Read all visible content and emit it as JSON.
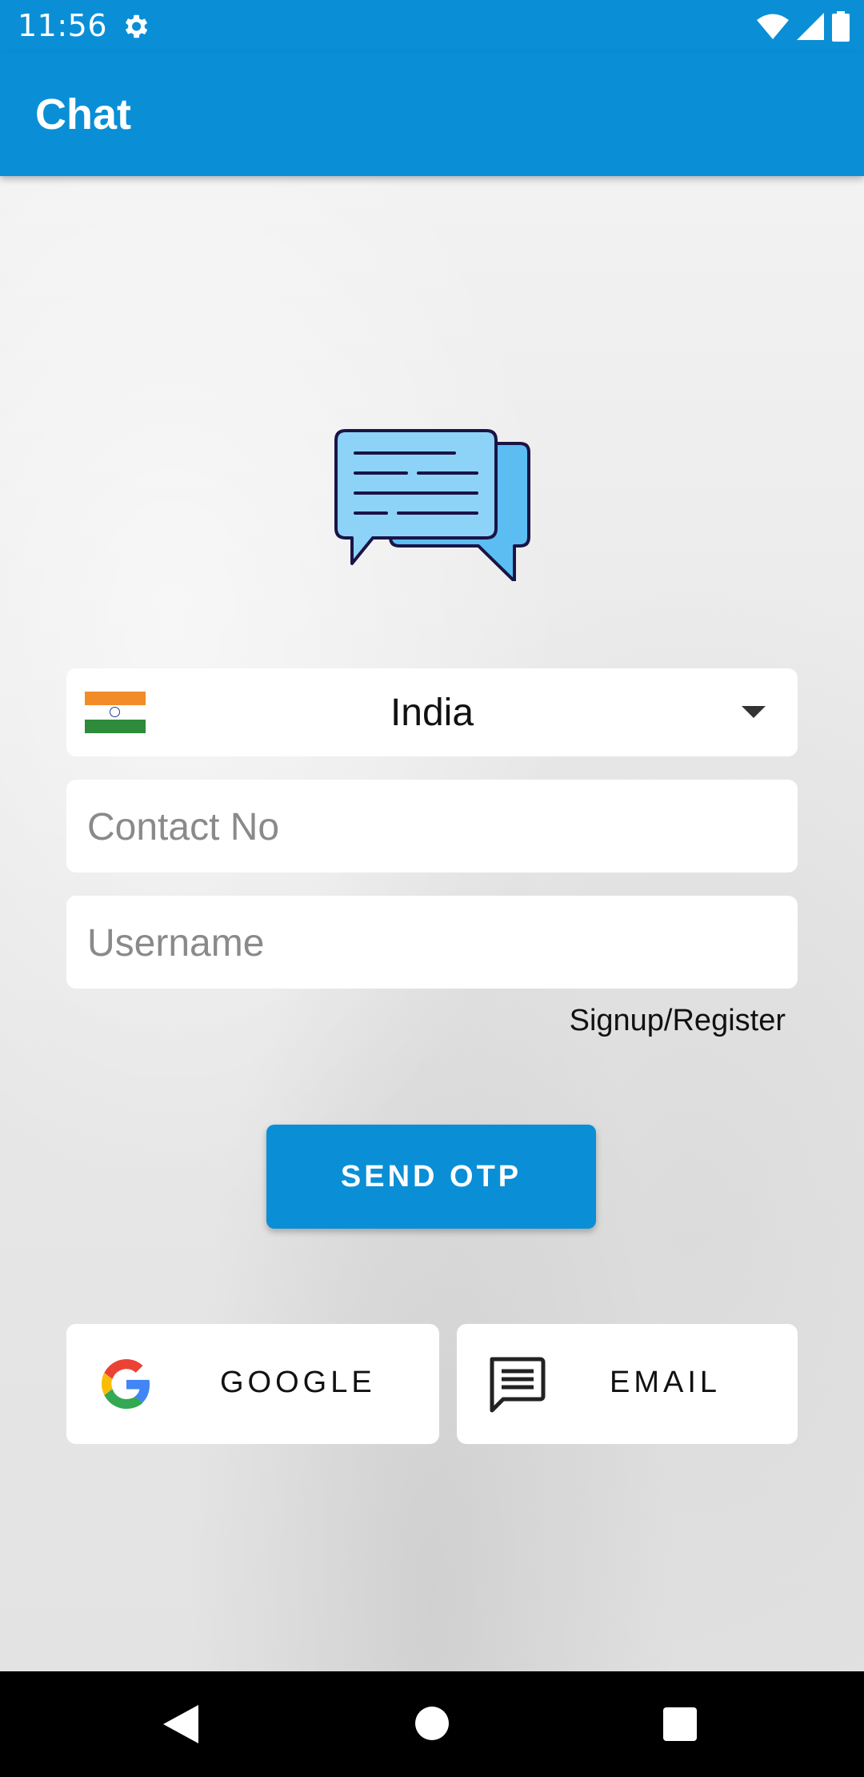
{
  "status_bar": {
    "time": "11:56",
    "icons": [
      "gear-icon",
      "wifi-icon",
      "signal-icon",
      "battery-icon"
    ]
  },
  "app_bar": {
    "title": "Chat"
  },
  "logo": {
    "icon": "chat-bubbles-icon"
  },
  "form": {
    "country": {
      "selected": "India",
      "flag_icon": "india-flag-icon"
    },
    "contact": {
      "placeholder": "Contact No",
      "value": ""
    },
    "username": {
      "placeholder": "Username",
      "value": ""
    },
    "signup_link": "Signup/Register",
    "send_otp_label": "SEND OTP"
  },
  "social": {
    "google_label": "GOOGLE",
    "email_label": "EMAIL"
  },
  "colors": {
    "primary": "#0a8fd6",
    "background": "#e9e9e9",
    "card": "#ffffff",
    "nav_bar": "#000000"
  }
}
